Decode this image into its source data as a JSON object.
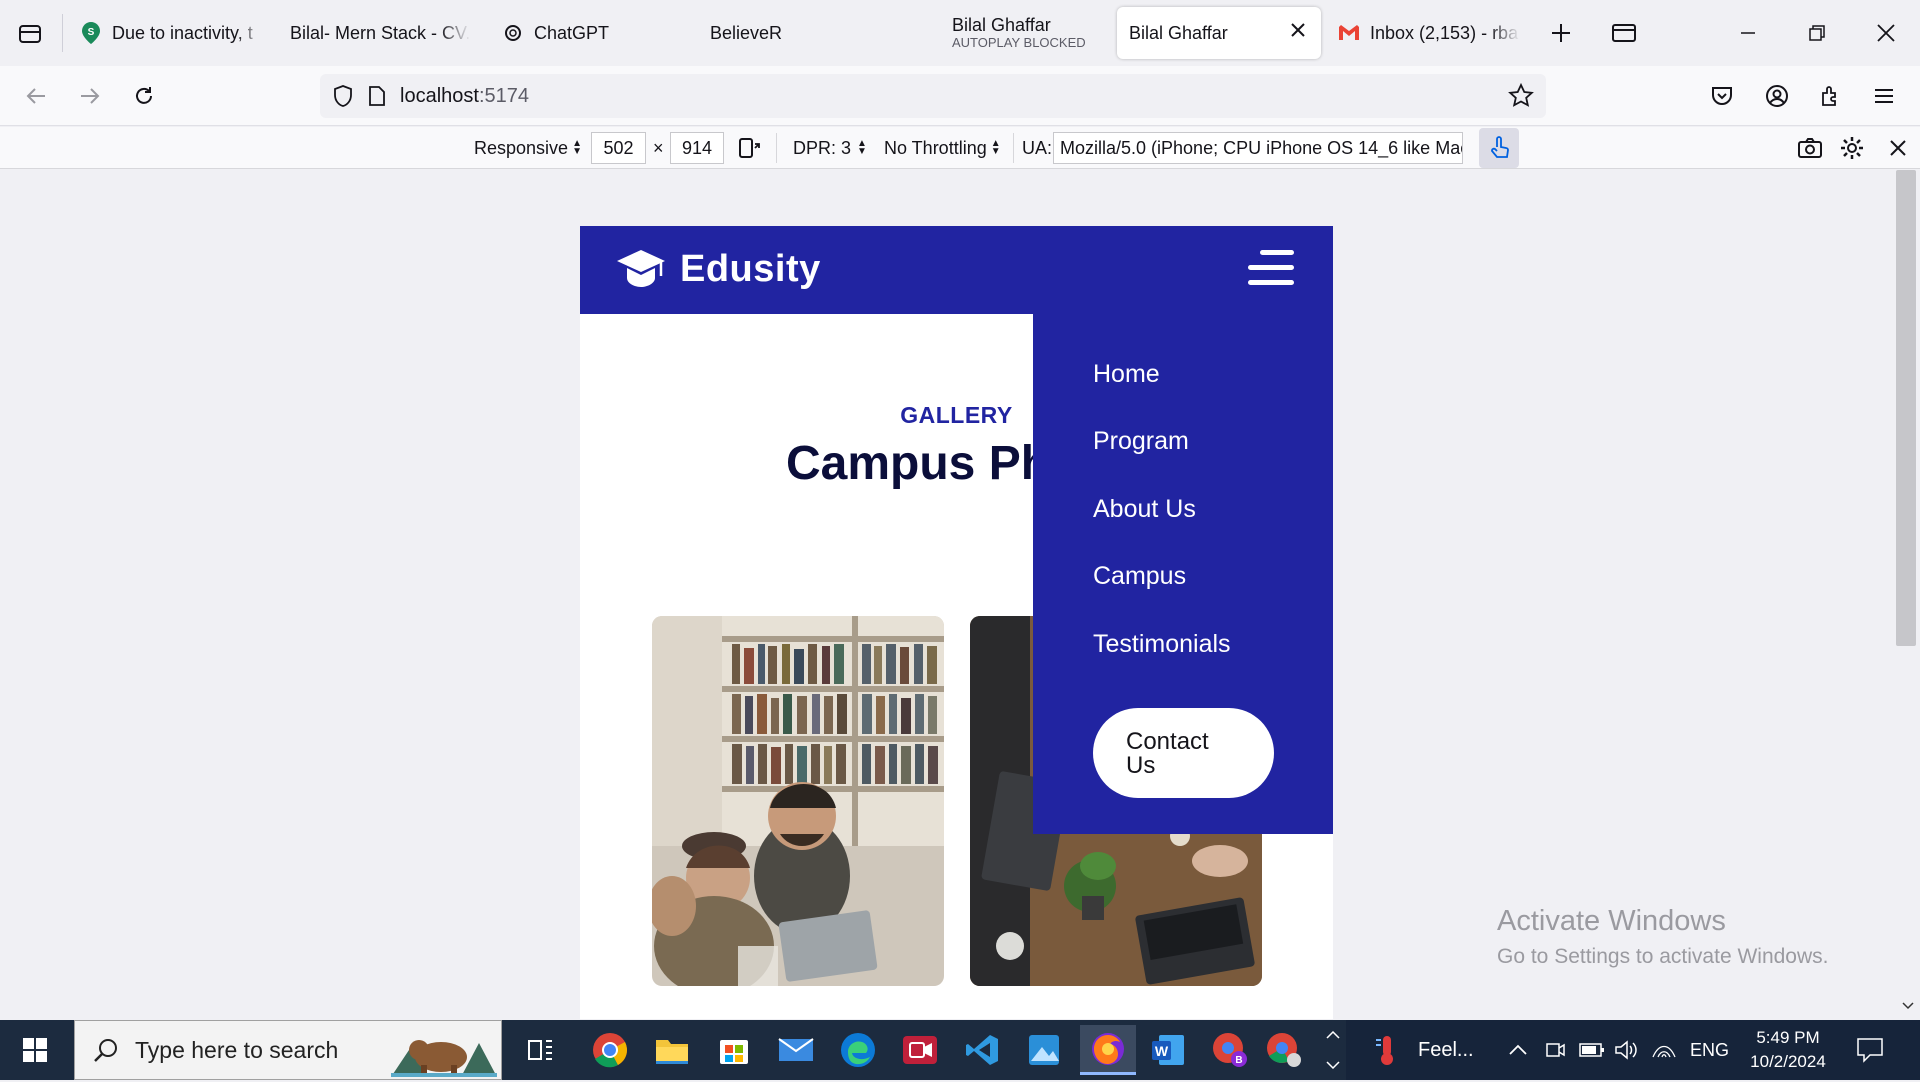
{
  "browser": {
    "tabs": [
      {
        "label": "Due to inactivity, t",
        "icon": "map-pin-icon"
      },
      {
        "label": "Bilal- Mern Stack - CV.",
        "icon": "none"
      },
      {
        "label": "ChatGPT",
        "icon": "chatgpt-icon"
      },
      {
        "label": "BelieveR",
        "icon": "none"
      },
      {
        "label": "Bilal Ghaffar",
        "sublabel": "AUTOPLAY BLOCKED",
        "icon": "none"
      },
      {
        "label": "Bilal Ghaffar",
        "icon": "none",
        "active": true
      },
      {
        "label": "Inbox (2,153) - rba",
        "icon": "gmail-icon"
      }
    ],
    "url_host": "localhost",
    "url_port": ":5174"
  },
  "rdm_toolbar": {
    "device": "Responsive",
    "width": "502",
    "times": "×",
    "height": "914",
    "dpr": "DPR: 3",
    "throttling": "No Throttling",
    "ua_label": "UA:",
    "ua_value": "Mozilla/5.0 (iPhone; CPU iPhone OS 14_6 like Mac"
  },
  "site": {
    "brand": "Edusity",
    "menu": [
      "Home",
      "Program",
      "About Us",
      "Campus",
      "Testimonials"
    ],
    "contact_line1": "Contact",
    "contact_line2": "Us",
    "gallery_subtitle": "GALLERY",
    "gallery_title": "Campus Ph"
  },
  "watermark": {
    "line1": "Activate Windows",
    "line2": "Go to Settings to activate Windows."
  },
  "taskbar": {
    "search_placeholder": "Type here to search",
    "weather": "Feel...",
    "lang": "ENG",
    "time": "5:49 PM",
    "date": "10/2/2024"
  },
  "colors": {
    "site_blue": "#2124a1",
    "title_navy": "#0b0e3a",
    "taskbar": "#1c2b3f"
  }
}
